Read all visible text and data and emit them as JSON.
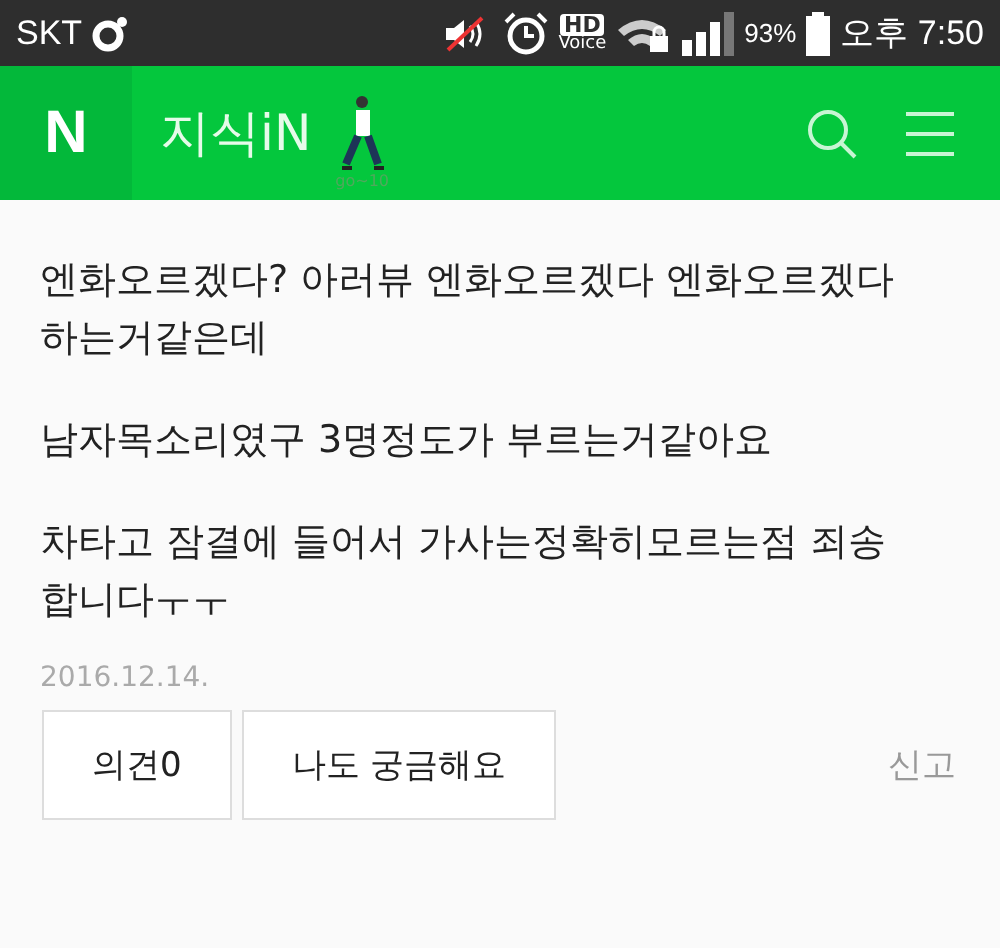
{
  "status_bar": {
    "carrier": "SKT",
    "hd": "HD",
    "voice": "Voice",
    "battery": "93%",
    "time": "오후 7:50"
  },
  "header": {
    "logo": "N",
    "title": "지식iN",
    "figure_caption": "go~10"
  },
  "paragraphs": [
    {
      "lines": [
        "엔화오르겠다? 아러뷰 엔화오르겠다 엔화오르겠다",
        "하는거같은데"
      ]
    },
    {
      "lines": [
        "남자목소리였구 3명정도가 부르는거같아요"
      ]
    },
    {
      "lines": [
        "차타고 잠결에 들어서 가사는정확히모르는점 죄송",
        "합니다ㅜㅜ"
      ]
    }
  ],
  "date": "2016.12.14.",
  "buttons": [
    "의견0",
    "나도 궁금해요"
  ],
  "report": "신고"
}
